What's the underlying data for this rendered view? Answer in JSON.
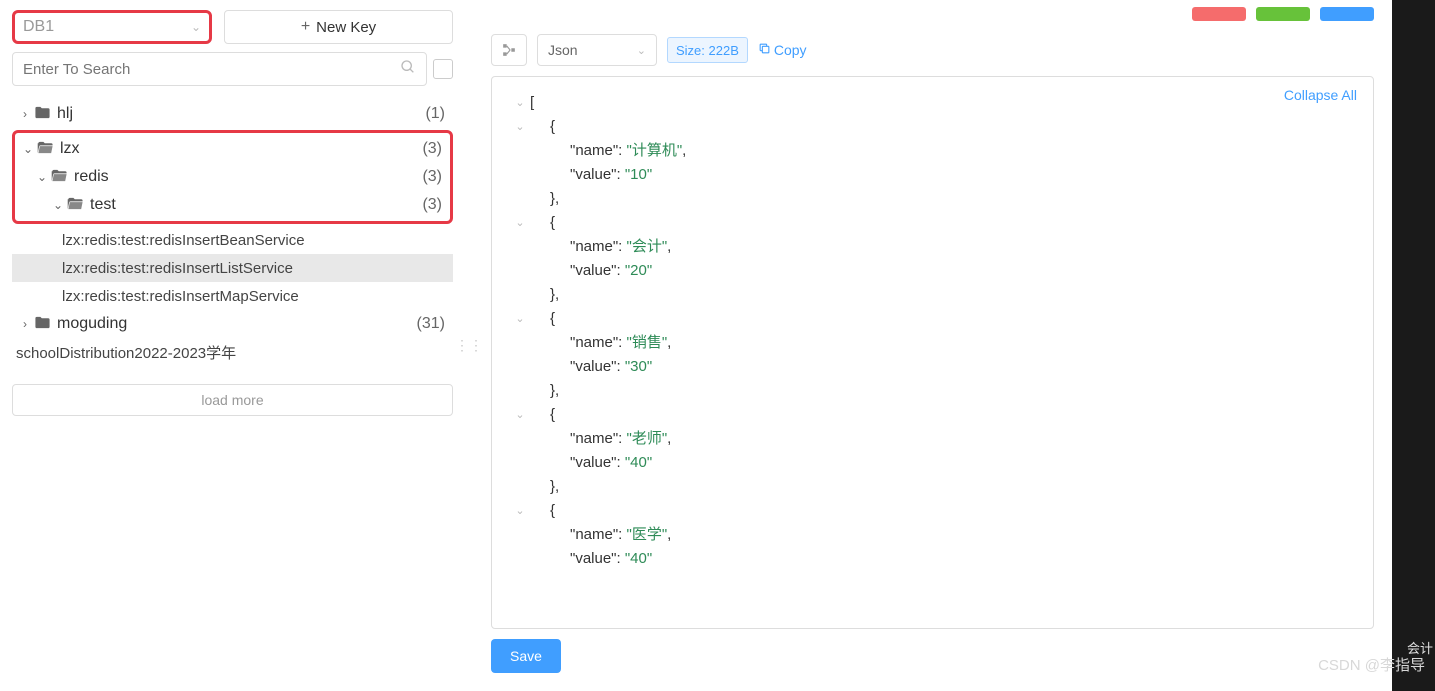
{
  "sidebar": {
    "db_label": "DB1",
    "new_key_label": "New Key",
    "search_placeholder": "Enter To Search",
    "load_more_label": "load more",
    "tree": [
      {
        "type": "folder",
        "name": "hlj",
        "count": "(1)",
        "expanded": false,
        "indent": 0
      },
      {
        "type": "hl_start"
      },
      {
        "type": "folder",
        "name": "lzx",
        "count": "(3)",
        "expanded": true,
        "open": true,
        "indent": 0
      },
      {
        "type": "folder",
        "name": "redis",
        "count": "(3)",
        "expanded": true,
        "open": true,
        "indent": 1
      },
      {
        "type": "folder",
        "name": "test",
        "count": "(3)",
        "expanded": true,
        "open": true,
        "indent": 2
      },
      {
        "type": "hl_end"
      },
      {
        "type": "key",
        "name": "lzx:redis:test:redisInsertBeanService",
        "selected": false
      },
      {
        "type": "key",
        "name": "lzx:redis:test:redisInsertListService",
        "selected": true
      },
      {
        "type": "key",
        "name": "lzx:redis:test:redisInsertMapService",
        "selected": false
      },
      {
        "type": "folder",
        "name": "moguding",
        "count": "(31)",
        "expanded": false,
        "indent": 0
      },
      {
        "type": "plain",
        "name": "schoolDistribution2022-2023学年"
      }
    ]
  },
  "main": {
    "format_label": "Json",
    "size_label": "Size: 222B",
    "copy_label": "Copy",
    "collapse_label": "Collapse All",
    "save_label": "Save"
  },
  "json_content": [
    {
      "name": "计算机",
      "value": "10"
    },
    {
      "name": "会计",
      "value": "20"
    },
    {
      "name": "销售",
      "value": "30"
    },
    {
      "name": "老师",
      "value": "40"
    },
    {
      "name": "医学",
      "value": "40"
    }
  ],
  "watermark": "CSDN @李指导",
  "watermark2": "会计"
}
